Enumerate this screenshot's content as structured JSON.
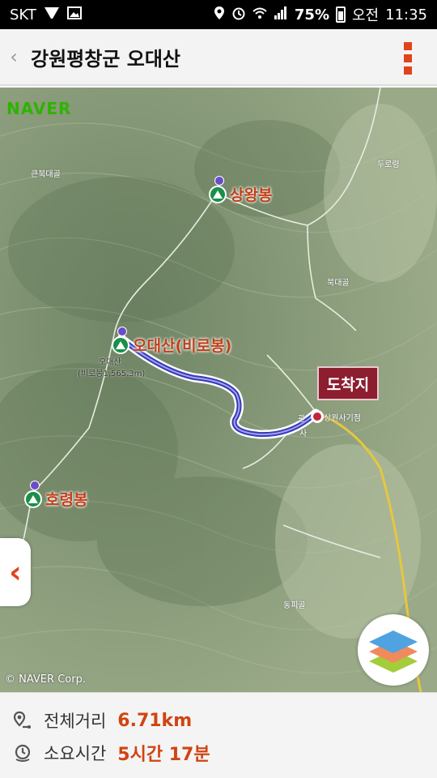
{
  "status_bar": {
    "carrier": "SKT",
    "battery": "75%",
    "ampm": "오전",
    "time": "11:35",
    "icons": [
      "vowifi-icon",
      "image-icon",
      "location-icon",
      "alarm-icon",
      "wifi-icon",
      "signal-icon",
      "battery-icon"
    ]
  },
  "header": {
    "title": "강원평창군 오대산",
    "back_icon": "chevron-left-icon",
    "menu_icon": "more-vertical-icon"
  },
  "map": {
    "provider_logo": "NAVER",
    "copyright": "© NAVER Corp.",
    "peaks": [
      {
        "name": "상왕봉"
      },
      {
        "name": "오대산(비로봉)"
      },
      {
        "name": "호령봉"
      }
    ],
    "labels": {
      "keunbukdaegol": "큰북대골",
      "durobong": "두로령",
      "bukdaegol": "북대골",
      "odaesan": "오대산",
      "birobong_height": "(비로봉1,565.3m)",
      "sangwonsa_parking": "상원사기점",
      "gwan": "관",
      "sa": "사",
      "dongpigol": "동피골"
    },
    "destination_label": "도착지",
    "colors": {
      "route": "#3838b8",
      "road": "#e8c640",
      "destination": "#8c1e30",
      "accent": "#e0441a"
    }
  },
  "info": {
    "distance_label": "전체거리",
    "distance_value": "6.71km",
    "time_label": "소요시간",
    "time_value": "5시간 17분"
  }
}
